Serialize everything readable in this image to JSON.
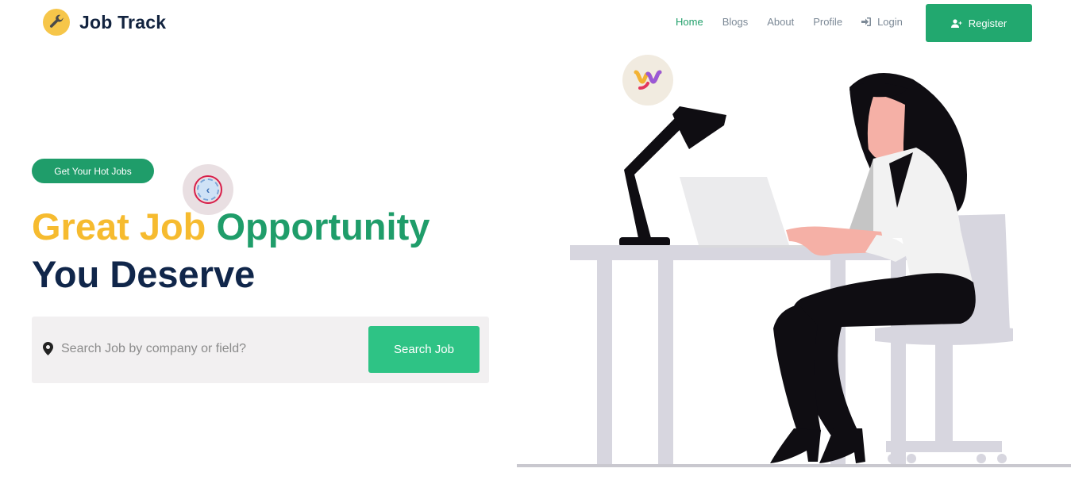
{
  "header": {
    "logo_text": "Job Track",
    "logo_icon": "wrench-icon",
    "nav": [
      {
        "label": "Home",
        "active": true
      },
      {
        "label": "Blogs",
        "active": false
      },
      {
        "label": "About",
        "active": false
      },
      {
        "label": "Profile",
        "active": false
      },
      {
        "label": "Login",
        "active": false,
        "icon": "sign-in-icon"
      }
    ],
    "register_label": "Register",
    "register_icon": "user-plus-icon"
  },
  "hero": {
    "pill_label": "Get Your Hot Jobs",
    "headline_part1": "Great Job",
    "headline_part2": "Opportunity",
    "headline_line2": "You Deserve",
    "search": {
      "placeholder": "Search Job by company or field?",
      "value": "",
      "icon": "map-pin-icon",
      "button_label": "Search Job"
    }
  },
  "colors": {
    "brand_green": "#22a86f",
    "headline_yellow": "#f6bb2f",
    "headline_navy": "#10264a",
    "search_button": "#2ec385"
  }
}
